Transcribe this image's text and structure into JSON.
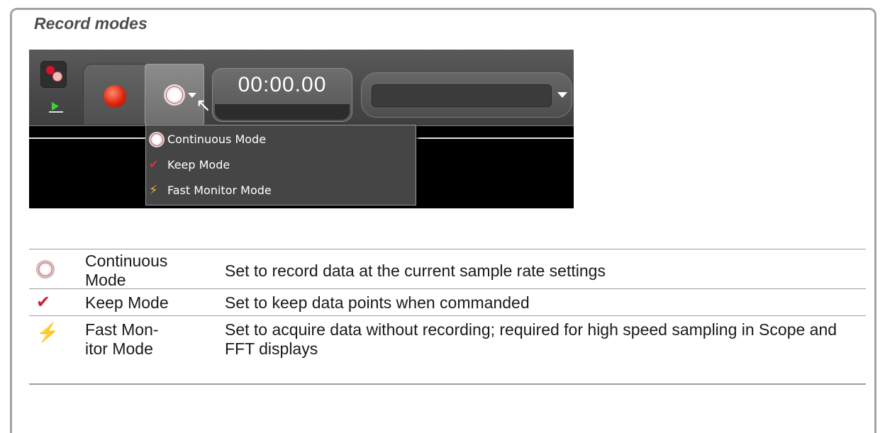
{
  "title": "Record modes",
  "toolbar": {
    "time_display": "00:00.00",
    "menu_items": [
      {
        "label": "Continuous Mode",
        "icon": "continuous-mode-icon"
      },
      {
        "label": "Keep Mode",
        "icon": "keep-mode-icon"
      },
      {
        "label": "Fast Monitor Mode",
        "icon": "fast-monitor-mode-icon"
      }
    ]
  },
  "table": {
    "rows": [
      {
        "icon": "continuous-mode-icon",
        "name": "Continuous Mode",
        "name_display": [
          "Continuous",
          "Mode"
        ],
        "description": "Set to record data at the current sample rate settings"
      },
      {
        "icon": "keep-mode-icon",
        "name": "Keep Mode",
        "name_display": [
          "Keep Mode"
        ],
        "description": "Set to keep data points when commanded"
      },
      {
        "icon": "fast-monitor-mode-icon",
        "name": "Fast Monitor Mode",
        "name_display": [
          "Fast Mon-",
          "itor Mode"
        ],
        "description": "Set to acquire data without recording; required for high speed sampling in Scope and FFT displays"
      }
    ]
  }
}
